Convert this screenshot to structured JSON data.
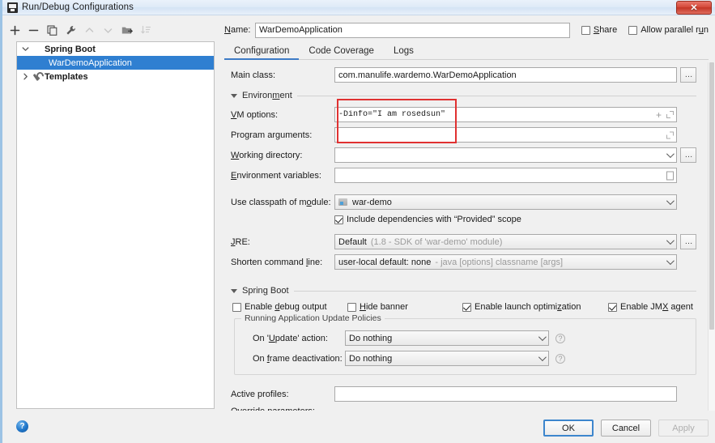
{
  "window": {
    "title": "Run/Debug Configurations",
    "app_icon": "intellij-idea-icon",
    "close_label": "✕"
  },
  "sidebar": {
    "toolbar": [
      {
        "name": "add-configuration-button",
        "glyph": "+",
        "enabled": true
      },
      {
        "name": "remove-configuration-button",
        "glyph": "−",
        "enabled": true
      },
      {
        "name": "copy-configuration-button",
        "glyph": "copy-icon",
        "enabled": true
      },
      {
        "name": "edit-templates-button",
        "glyph": "wrench-icon",
        "enabled": true
      },
      {
        "name": "move-up-button",
        "glyph": "▲",
        "enabled": false
      },
      {
        "name": "move-down-button",
        "glyph": "▼",
        "enabled": false
      },
      {
        "name": "move-into-folder-button",
        "glyph": "folder-icon",
        "enabled": true
      },
      {
        "name": "sort-configurations-button",
        "glyph": "sort-icon",
        "enabled": false
      }
    ],
    "tree": [
      {
        "label": "Spring Boot",
        "icon": "spring-boot-icon",
        "level": 1,
        "expanded": true,
        "selected": false,
        "bold": true
      },
      {
        "label": "WarDemoApplication",
        "icon": "spring-boot-icon",
        "level": 2,
        "expanded": null,
        "selected": true,
        "bold": false
      },
      {
        "label": "Templates",
        "icon": "wrench-icon",
        "level": 1,
        "expanded": false,
        "selected": false,
        "bold": true
      }
    ],
    "help_label": "?"
  },
  "header": {
    "name_label": "Name:",
    "name_value": "WarDemoApplication",
    "name_placeholder": "",
    "share_label": "Share",
    "share_checked": false,
    "allow_parallel_label": "Allow parallel run",
    "allow_parallel_checked": false
  },
  "tabs": [
    {
      "label": "Configuration",
      "active": true
    },
    {
      "label": "Code Coverage",
      "active": false
    },
    {
      "label": "Logs",
      "active": false
    }
  ],
  "form": {
    "main_class": {
      "label": "Main class:",
      "value": "com.manulife.wardemo.WarDemoApplication",
      "browse_label": "…"
    },
    "environment_section": "Environment",
    "vm_options": {
      "label": "VM options:",
      "value": "-Dinfo=\"I am rosedsun\"",
      "add_icon": "+",
      "expand_icon": "expand-icon"
    },
    "program_arguments": {
      "label": "Program arguments:",
      "value": "",
      "expand_icon": "expand-icon"
    },
    "working_directory": {
      "label": "Working directory:",
      "value": "",
      "browse_label": "…"
    },
    "environment_variables": {
      "label": "Environment variables:",
      "value": "",
      "browse_label": "document-icon"
    },
    "use_classpath": {
      "label": "Use classpath of module:",
      "value": "war-demo",
      "icon": "module-icon"
    },
    "include_provided": {
      "label": "Include dependencies with “Provided” scope",
      "checked": true
    },
    "jre": {
      "label": "JRE:",
      "value": "Default",
      "hint": "(1.8 - SDK of 'war-demo' module)",
      "browse_label": "…"
    },
    "shorten_command_line": {
      "label": "Shorten command line:",
      "value": "user-local default: none",
      "hint": "- java [options] classname [args]"
    },
    "spring_boot_section": "Spring Boot",
    "spring_checkboxes": [
      {
        "label": "Enable debug output",
        "checked": false,
        "name": "enable-debug-output-checkbox"
      },
      {
        "label": "Hide banner",
        "checked": false,
        "name": "hide-banner-checkbox"
      },
      {
        "label": "Enable launch optimization",
        "checked": true,
        "name": "enable-launch-optimization-checkbox"
      },
      {
        "label": "Enable JMX agent",
        "checked": true,
        "name": "enable-jmx-agent-checkbox"
      }
    ],
    "update_policies": {
      "group_title": "Running Application Update Policies",
      "on_update_label": "On 'Update' action:",
      "on_update_value": "Do nothing",
      "on_frame_label": "On frame deactivation:",
      "on_frame_value": "Do nothing",
      "help_glyph": "?"
    },
    "active_profiles": {
      "label": "Active profiles:",
      "value": ""
    },
    "override_parameters": {
      "label": "Override parameters:"
    }
  },
  "buttons": {
    "ok": "OK",
    "cancel": "Cancel",
    "apply": "Apply"
  },
  "colors": {
    "selection_blue": "#2f7fd1",
    "tab_accent": "#3d7bc6",
    "highlight_red": "#e03131",
    "close_red": "#c33626"
  }
}
